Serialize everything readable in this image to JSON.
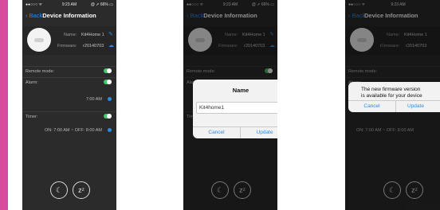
{
  "status_bar": {
    "signal": "●●○○○ ᯤ",
    "time": "9:23 AM",
    "battery": "@ ➚ 66% ▭"
  },
  "nav": {
    "back_label": "Back",
    "title": "Device Information"
  },
  "device": {
    "name_label": "Name:",
    "name_value": "Kit4Home 1",
    "firmware_label": "Firmware:",
    "firmware_value": "r20140703"
  },
  "settings": {
    "remote_mode_label": "Remote mode:",
    "alarm_label": "Alarm:",
    "alarm_time": "7:00 AM",
    "timer_label": "Timer:",
    "timer_value": "ON: 7:00 AM  ~  OFF: 8:00 AM"
  },
  "bottom": {
    "moon_icon": "moon-icon",
    "sleep_icon": "zz-icon"
  },
  "rename_dialog": {
    "title": "Name",
    "input_value": "Kit4home1",
    "cancel_label": "Cancel",
    "update_label": "Update"
  },
  "firmware_dialog": {
    "message_line1": "The new firmware version",
    "message_line2": "is available for your device",
    "cancel_label": "Cancel",
    "update_label": "Update"
  },
  "colors": {
    "accent": "#2f8ae0",
    "toggle_on": "#44c767",
    "edge_bar": "#d84a9e"
  }
}
